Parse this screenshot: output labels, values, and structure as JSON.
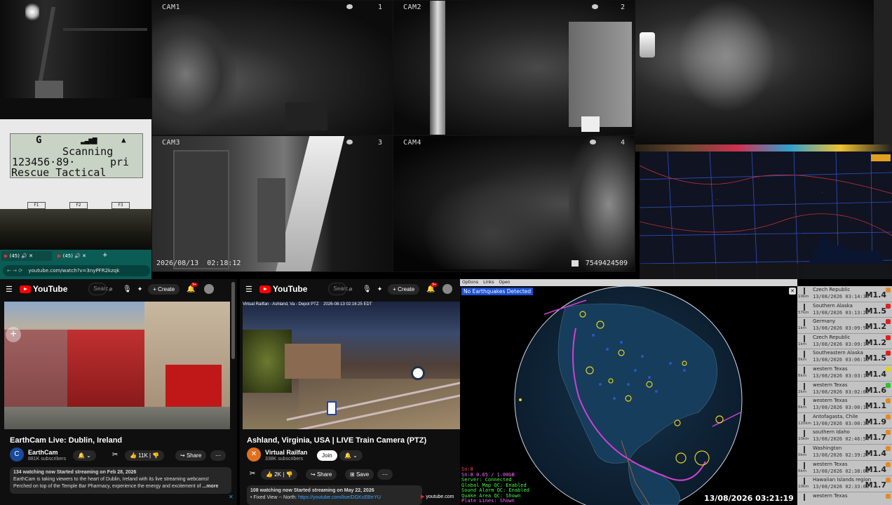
{
  "cctv": {
    "cams": [
      {
        "label": "CAM1",
        "num": "1"
      },
      {
        "label": "CAM2",
        "num": "2"
      },
      {
        "label": "CAM3",
        "num": "3"
      },
      {
        "label": "CAM4",
        "num": "4"
      }
    ],
    "timestamp": "2026/08/13  02:18:12",
    "counter": "7549424509"
  },
  "scanner": {
    "line1_left": "G",
    "line2": "Scanning",
    "line3_freq": "123456·89·",
    "line3_pri": "pri",
    "line4": "Rescue Tactical",
    "softkeys": [
      "F1",
      "F2",
      "F3"
    ]
  },
  "browser": {
    "tabs": [
      "(45)",
      "(45)"
    ],
    "url": "youtube.com/watch?v=3nyPFR2kzqk"
  },
  "youtube_left": {
    "logo": "YouTube",
    "search_placeholder": "Searc",
    "create_label": "+ Create",
    "notif_count": "9+",
    "title": "EarthCam Live: Dublin, Ireland",
    "channel": "EarthCam",
    "subscribers": "881K subscribers",
    "likes": "11K",
    "share": "Share",
    "desc_line1": "134 watching now  Started streaming on Feb 28, 2026",
    "desc_line2": "EarthCam is taking viewers to the heart of Dublin, Ireland with its live streaming webcams!",
    "desc_line3": "Perched on top of the Temple Bar Pharmacy, experience the energy and excitement of",
    "more": "...more"
  },
  "youtube_right": {
    "logo": "YouTube",
    "search_placeholder": "Searc",
    "create_label": "+ Create",
    "notif_count": "9+",
    "overlay": "Virtual Railfan - Ashland, Va - Depot PTZ    2026-08-13 02:16:25 EDT",
    "title": "Ashland, Virginia, USA | LIVE Train Camera (PTZ)",
    "channel": "Virtual Railfan",
    "subscribers": "338K subscribers",
    "join": "Join",
    "likes": "2K",
    "share": "Share",
    "save": "Save",
    "desc_line1": "108 watching now  Started streaming on May 22, 2026",
    "desc_line2_prefix": "• Fixed View -- North:",
    "desc_line2_link": "https://youtube.com/live/DGKcEBrrYU",
    "footer": "youtube.com"
  },
  "quake_map": {
    "menu": [
      "Options",
      "Links",
      "Open"
    ],
    "banner": "No Earthquakes Detected",
    "datetime": "13/08/2026 03:21:19",
    "status": [
      {
        "text": "Sn:8",
        "color": "#ff4444"
      },
      {
        "text": "Sn:8 0.65 / 1.00GB",
        "color": "#ff66ff"
      },
      {
        "text": "Server: Connected",
        "color": "#44ff44"
      },
      {
        "text": "Global Map QC: Enabled",
        "color": "#44ff44"
      },
      {
        "text": "Sound Alarm QC: Enabled",
        "color": "#44ff44"
      },
      {
        "text": "Quake Area QC: Shown",
        "color": "#44ff44"
      },
      {
        "text": "Plate Lines: Shown",
        "color": "#ff66ff"
      }
    ]
  },
  "quakes": [
    {
      "place": "Czech Republic",
      "time": "13/08/2026 03:14:36",
      "mag": "M1.4",
      "dist": "10km",
      "color": "#e08a2a"
    },
    {
      "place": "Southern Alaska",
      "time": "13/08/2026 03:13:22",
      "mag": "M1.5",
      "dist": "57km",
      "color": "#e02020"
    },
    {
      "place": "Germany",
      "time": "13/08/2026 03:09:54",
      "mag": "M1.2",
      "dist": "1km",
      "color": "#e02020"
    },
    {
      "place": "Czech Republic",
      "time": "13/08/2026 03:09:14",
      "mag": "M1.2",
      "dist": "1km",
      "color": "#e02020"
    },
    {
      "place": "Southeastern Alaska",
      "time": "13/08/2026 03:06:16",
      "mag": "M1.5",
      "dist": "0km",
      "color": "#e02020"
    },
    {
      "place": "western Texas",
      "time": "13/08/2026 03:03:14",
      "mag": "M1.4",
      "dist": "6km",
      "color": "#e0d020"
    },
    {
      "place": "western Texas",
      "time": "13/08/2026 03:02:09",
      "mag": "M1.6",
      "dist": "2km",
      "color": "#30c030"
    },
    {
      "place": "western Texas",
      "time": "13/08/2026 03:00:12",
      "mag": "M1.1",
      "dist": "6km",
      "color": "#e08a2a"
    },
    {
      "place": "Antofagasta, Chile",
      "time": "13/08/2026 03:00:38",
      "mag": "M1.9",
      "dist": "120km",
      "color": "#e08a2a"
    },
    {
      "place": "southern Idaho",
      "time": "13/08/2026 02:46:54",
      "mag": "M1.7",
      "dist": "10km",
      "color": "#e08a2a"
    },
    {
      "place": "Washington",
      "time": "13/08/2026 02:39:27",
      "mag": "M1.4",
      "dist": "0km",
      "color": "#e08a2a"
    },
    {
      "place": "western Texas",
      "time": "13/08/2026 02:38:03",
      "mag": "M1.4",
      "dist": "6km",
      "color": "#e08a2a"
    },
    {
      "place": "Hawaiian Islands region",
      "time": "13/08/2026 02:33:09",
      "mag": "M1.7",
      "dist": "10km",
      "color": "#e08a2a"
    },
    {
      "place": "western Texas",
      "time": "",
      "mag": "",
      "dist": "",
      "color": "#e08a2a"
    }
  ],
  "colors": {
    "yt_red": "#ff0000",
    "quake_banner": "#1a4fd0",
    "panel_grey": "#c3c3c3"
  }
}
